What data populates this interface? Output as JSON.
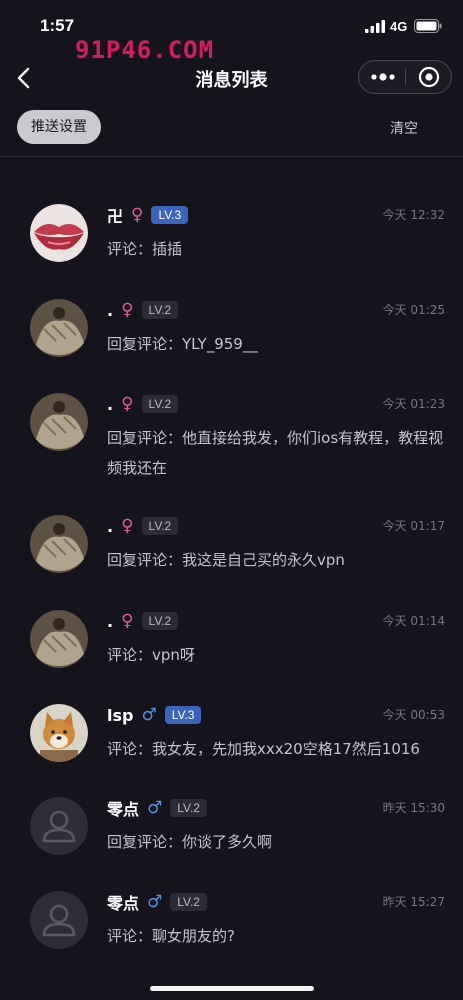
{
  "status": {
    "time": "1:57",
    "network": "4G"
  },
  "watermark": "91P46.COM",
  "nav": {
    "title": "消息列表"
  },
  "toolbar": {
    "push_settings": "推送设置",
    "clear": "清空"
  },
  "messages": [
    {
      "name": "卍",
      "gender": "♀",
      "level": "LV.3",
      "time": "今天 12:32",
      "content": "评论：插插",
      "avatar": "lips"
    },
    {
      "name": ".",
      "gender": "♀",
      "level": "LV.2",
      "time": "今天 01:25",
      "content": "回复评论：YLY_959__",
      "avatar": "photo"
    },
    {
      "name": ".",
      "gender": "♀",
      "level": "LV.2",
      "time": "今天 01:23",
      "content": "回复评论：他直接给我发，你们ios有教程，教程视频我还在",
      "avatar": "photo"
    },
    {
      "name": ".",
      "gender": "♀",
      "level": "LV.2",
      "time": "今天 01:17",
      "content": "回复评论：我这是自己买的永久vpn",
      "avatar": "photo"
    },
    {
      "name": ".",
      "gender": "♀",
      "level": "LV.2",
      "time": "今天 01:14",
      "content": "评论：vpn呀",
      "avatar": "photo"
    },
    {
      "name": "lsp",
      "gender": "♂",
      "level": "LV.3",
      "time": "今天 00:53",
      "content": "评论：我女友，先加我xxx20空格17然后1016",
      "avatar": "dog"
    },
    {
      "name": "零点",
      "gender": "♂",
      "level": "LV.2",
      "time": "昨天 15:30",
      "content": "回复评论：你谈了多久啊",
      "avatar": "default"
    },
    {
      "name": "零点",
      "gender": "♂",
      "level": "LV.2",
      "time": "昨天 15:27",
      "content": "评论：聊女朋友的?",
      "avatar": "default"
    }
  ]
}
